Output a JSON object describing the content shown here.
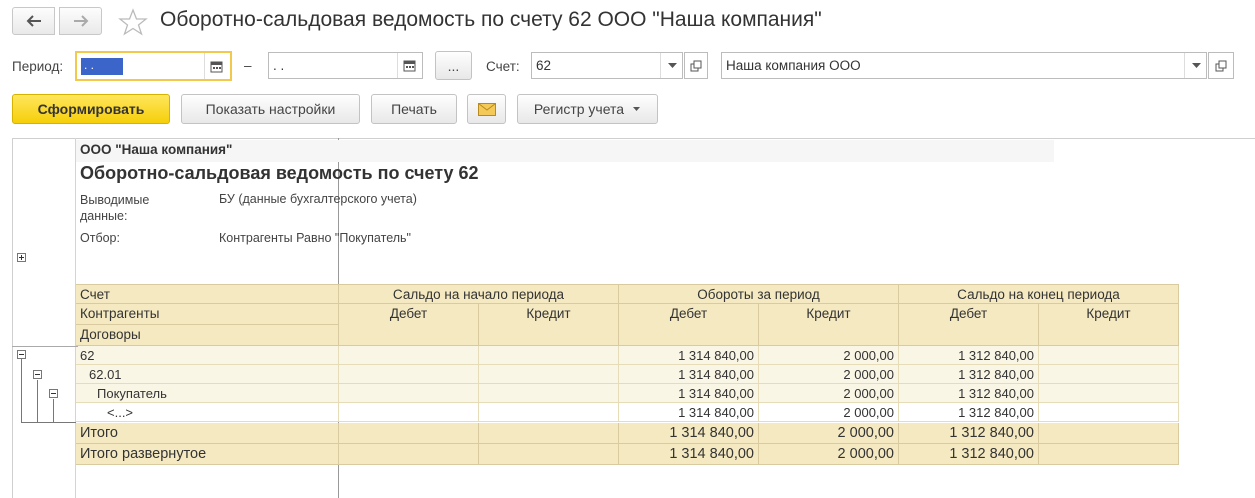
{
  "window": {
    "title": "Оборотно-сальдовая ведомость по счету 62 ООО \"Наша компания\""
  },
  "filters": {
    "period_label": "Период:",
    "period_from": " .  .",
    "period_dash": "–",
    "period_to": " .  .",
    "period_more": "...",
    "account_label": "Счет:",
    "account_value": "62",
    "org_value": "Наша компания ООО"
  },
  "toolbar": {
    "generate": "Сформировать",
    "show_settings": "Показать настройки",
    "print": "Печать",
    "register": "Регистр учета"
  },
  "report": {
    "org_name": "ООО \"Наша компания\"",
    "title": "Оборотно-сальдовая ведомость по счету 62",
    "output_label": "Выводимые данные:",
    "output_label_l1": "Выводимые",
    "output_label_l2": "данные:",
    "output_value": "БУ (данные бухгалтерского учета)",
    "filter_label": "Отбор:",
    "filter_value": "Контрагенты Равно \"Покупатель\"",
    "headers": {
      "account": "Счет",
      "counterparties": "Контрагенты",
      "contracts": "Договоры",
      "opening": "Сальдо на начало периода",
      "turnover": "Обороты за период",
      "closing": "Сальдо на конец периода",
      "debit": "Дебет",
      "credit": "Кредит"
    },
    "rows": [
      {
        "name": "62",
        "open_d": "",
        "open_c": "",
        "turn_d": "1 314 840,00",
        "turn_c": "2 000,00",
        "close_d": "1 312 840,00",
        "close_c": ""
      },
      {
        "name": "62.01",
        "open_d": "",
        "open_c": "",
        "turn_d": "1 314 840,00",
        "turn_c": "2 000,00",
        "close_d": "1 312 840,00",
        "close_c": ""
      },
      {
        "name": "Покупатель",
        "open_d": "",
        "open_c": "",
        "turn_d": "1 314 840,00",
        "turn_c": "2 000,00",
        "close_d": "1 312 840,00",
        "close_c": ""
      },
      {
        "name": "<...>",
        "open_d": "",
        "open_c": "",
        "turn_d": "1 314 840,00",
        "turn_c": "2 000,00",
        "close_d": "1 312 840,00",
        "close_c": ""
      }
    ],
    "totals": [
      {
        "name": "Итого",
        "open_d": "",
        "open_c": "",
        "turn_d": "1 314 840,00",
        "turn_c": "2 000,00",
        "close_d": "1 312 840,00",
        "close_c": ""
      },
      {
        "name": "Итого развернутое",
        "open_d": "",
        "open_c": "",
        "turn_d": "1 314 840,00",
        "turn_c": "2 000,00",
        "close_d": "1 312 840,00",
        "close_c": ""
      }
    ]
  }
}
